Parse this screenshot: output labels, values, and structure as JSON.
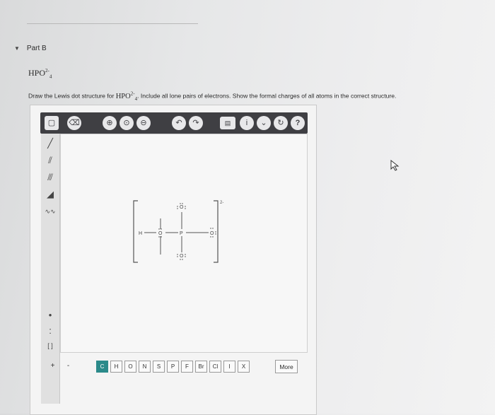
{
  "part": {
    "label": "Part B"
  },
  "question": {
    "formula_main": "HPO",
    "formula_super": "2-",
    "formula_sub": "4",
    "instruction_before": "Draw the Lewis dot structure for ",
    "instruction_after": ". Include all lone pairs of electrons. Show the formal charges of all atoms in the correct structure."
  },
  "toolbar": {
    "icons": [
      "select-icon",
      "eraser-icon",
      "zoom-in-icon",
      "zoom-reset-icon",
      "zoom-out-icon",
      "undo-icon",
      "redo-icon",
      "clipboard-icon",
      "info-icon",
      "chevron-down-icon",
      "help-icon"
    ],
    "help_label": "?"
  },
  "left_tools": [
    "single-bond",
    "double-bond",
    "triple-bond",
    "wedge-bond",
    "chain",
    "lone-pair",
    "radical",
    "bracket"
  ],
  "structure": {
    "atoms": [
      "H",
      "O",
      "P",
      "O",
      "O",
      "O"
    ],
    "charge": "2-"
  },
  "element_palette": [
    "C",
    "H",
    "O",
    "N",
    "S",
    "P",
    "F",
    "Br",
    "Cl",
    "I",
    "X"
  ],
  "element_active": "C",
  "charge_buttons": [
    "+",
    "-"
  ],
  "more_label": "More"
}
